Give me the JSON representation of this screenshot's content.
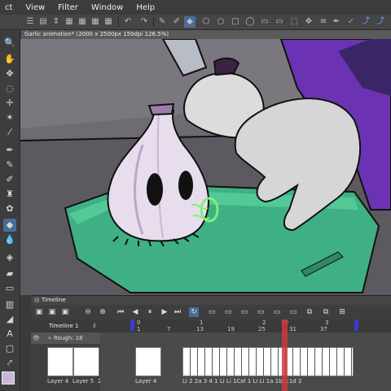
{
  "menu": [
    "ct",
    "View",
    "Filter",
    "Window",
    "Help"
  ],
  "document_tab": "Garlic animation* (2000 x 2500px 150dpi 126.5%)",
  "timeline": {
    "panel_title": "Timeline",
    "name": "Timeline 1",
    "layer_name": "Rough: 18",
    "ruler_top": [
      "0",
      "1",
      "2",
      "3"
    ],
    "ruler_bottom": [
      "1",
      "7",
      "13",
      "19",
      "25",
      "29",
      "31",
      "37"
    ],
    "cel_labels_left": [
      "Layer 4",
      "Layer 5",
      "2"
    ],
    "cel_labels_mid": "Layer 4",
    "cel_labels_right": [
      "Li 2",
      "2a",
      "3",
      "4",
      "1",
      "Li Li 1Cel 1",
      "Li Li 1a",
      "1b1c1d",
      "2"
    ]
  },
  "colors": {
    "accent": "#4a6c96",
    "playhead": "#cc3a3a",
    "marker": "#3a3ad0"
  }
}
